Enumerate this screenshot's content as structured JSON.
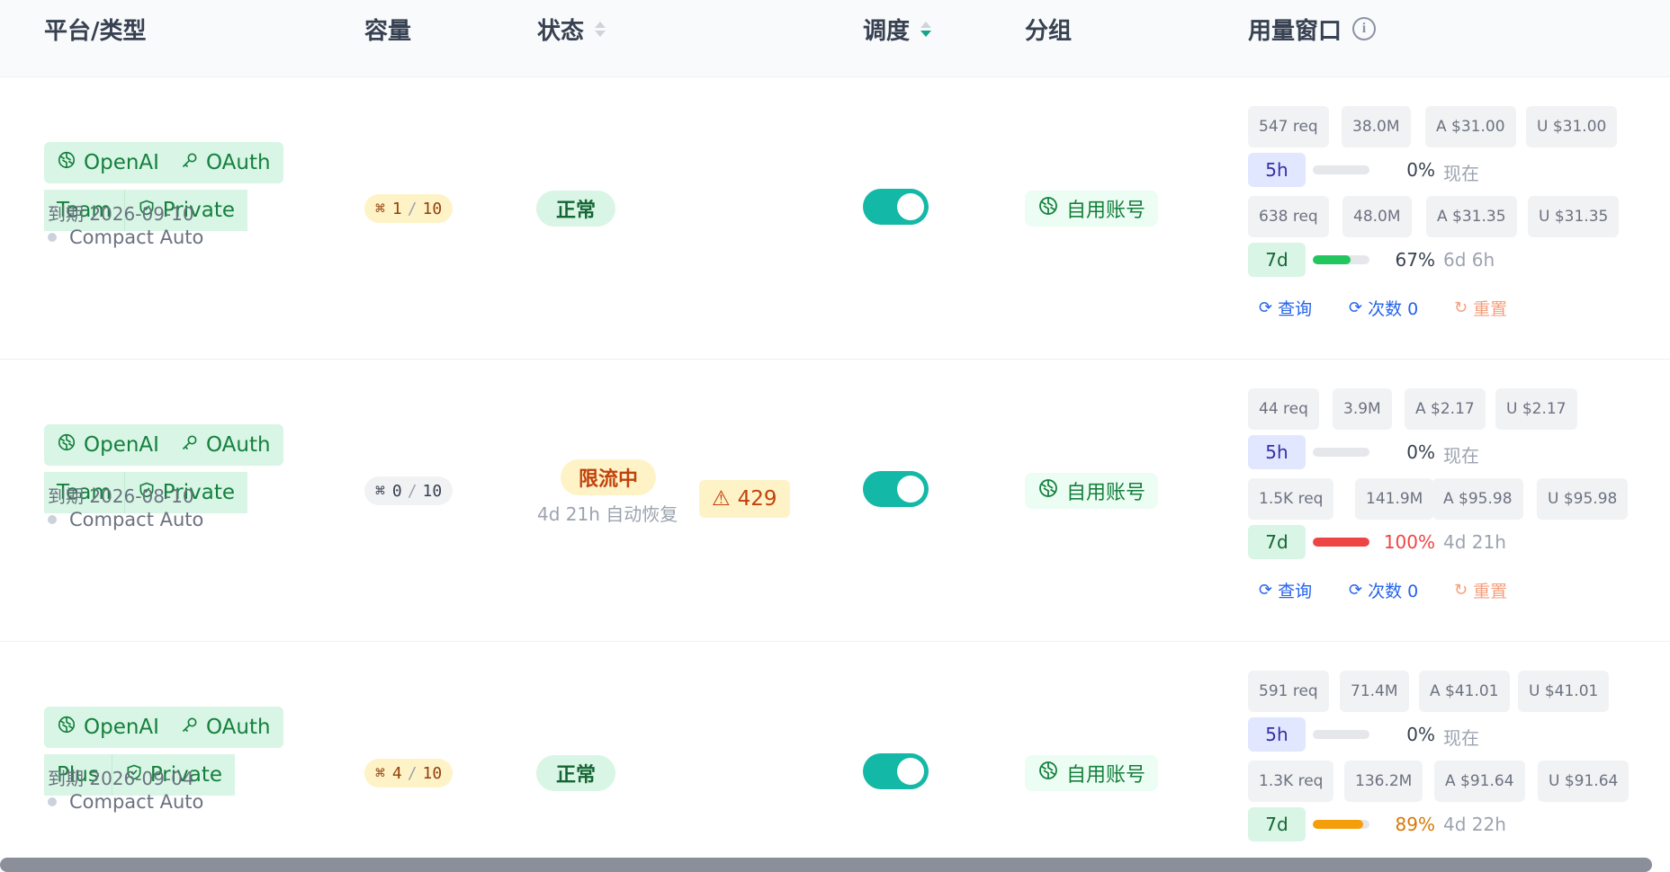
{
  "headers": {
    "platform": "平台/类型",
    "capacity": "容量",
    "status": "状态",
    "schedule": "调度",
    "group": "分组",
    "usage": "用量窗口"
  },
  "rows": [
    {
      "platform": "OpenAI",
      "auth": "OAuth",
      "plan": "Team",
      "privacy": "Private",
      "expire": "到期 2026-09-10",
      "mode": "Compact Auto",
      "cap_used": "1",
      "cap_total": "10",
      "status": "正常",
      "group": "自用账号",
      "w5_stats": [
        "547 req",
        "38.0M",
        "A $31.00",
        "U $31.00"
      ],
      "w5_label": "5h",
      "w5_fill": 0,
      "w5_pct": "0%",
      "w5_when": "现在",
      "w7_stats": [
        "638 req",
        "48.0M",
        "A $31.35",
        "U $31.35"
      ],
      "w7_label": "7d",
      "w7_fill": 67,
      "w7_pct": "67%",
      "w7_when": "6d 6h",
      "actions": [
        "查询",
        "次数 0",
        "重置"
      ]
    },
    {
      "platform": "OpenAI",
      "auth": "OAuth",
      "plan": "Team",
      "privacy": "Private",
      "expire": "到期 2026-08-10",
      "mode": "Compact Auto",
      "cap_used": "0",
      "cap_total": "10",
      "status": "限流中",
      "recover": "4d 21h 自动恢复",
      "code": "429",
      "group": "自用账号",
      "w5_stats": [
        "44 req",
        "3.9M",
        "A $2.17",
        "U $2.17"
      ],
      "w5_label": "5h",
      "w5_fill": 0,
      "w5_pct": "0%",
      "w5_when": "现在",
      "w7_stats": [
        "1.5K req",
        "141.9M",
        "A $95.98",
        "U $95.98"
      ],
      "w7_label": "7d",
      "w7_fill": 100,
      "w7_pct": "100%",
      "w7_when": "4d 21h",
      "actions": [
        "查询",
        "次数 0",
        "重置"
      ]
    },
    {
      "platform": "OpenAI",
      "auth": "OAuth",
      "plan": "Plus",
      "privacy": "Private",
      "expire": "到期 2026-09-04",
      "mode": "Compact Auto",
      "cap_used": "4",
      "cap_total": "10",
      "status": "正常",
      "group": "自用账号",
      "w5_stats": [
        "591 req",
        "71.4M",
        "A $41.01",
        "U $41.01"
      ],
      "w5_label": "5h",
      "w5_fill": 0,
      "w5_pct": "0%",
      "w5_when": "现在",
      "w7_stats": [
        "1.3K req",
        "136.2M",
        "A $91.64",
        "U $91.64"
      ],
      "w7_label": "7d",
      "w7_fill": 89,
      "w7_pct": "89%",
      "w7_when": "4d 22h"
    }
  ],
  "colors": {
    "bar_green": "#22c55e",
    "bar_red": "#ef4444",
    "bar_orange": "#f59e0b",
    "pct_red": "#ef4444",
    "pct_orange": "#d97706"
  }
}
